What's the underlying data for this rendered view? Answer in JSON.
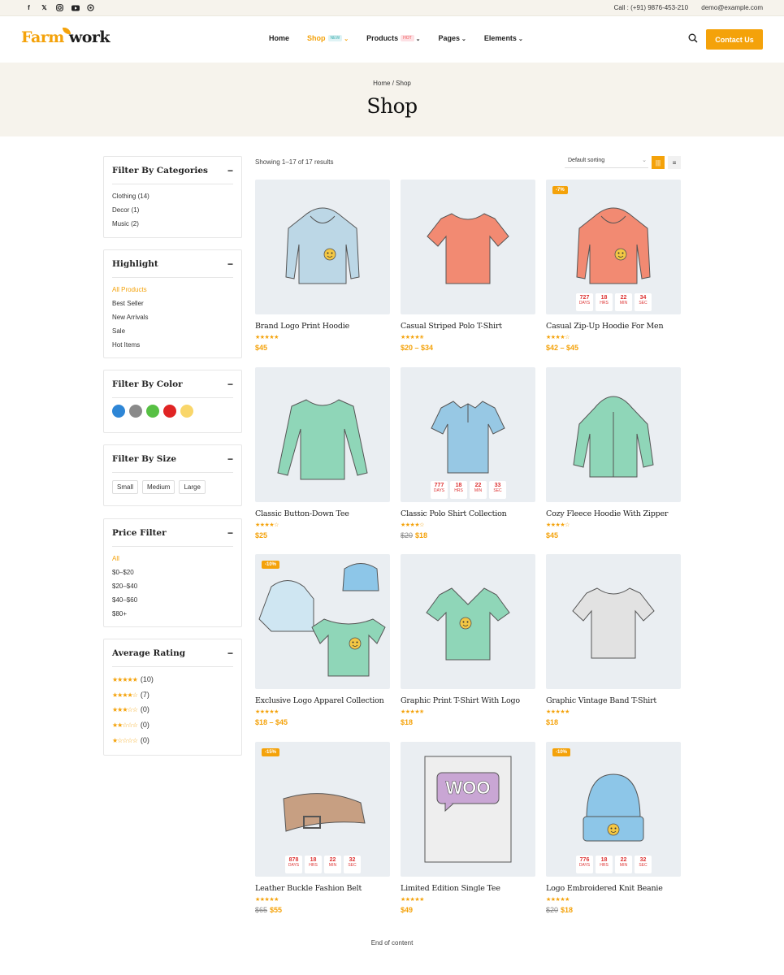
{
  "topbar": {
    "social": [
      "facebook-icon",
      "x-icon",
      "instagram-icon",
      "youtube-icon",
      "whatsapp-icon"
    ],
    "call": "Call : (+91) 9876-453-210",
    "email": "demo@example.com"
  },
  "header": {
    "logo_left": "Farm",
    "logo_right": "work",
    "nav": [
      {
        "label": "Home"
      },
      {
        "label": "Shop",
        "tag": "NEW"
      },
      {
        "label": "Products",
        "tag": "HOT"
      },
      {
        "label": "Pages"
      },
      {
        "label": "Elements"
      }
    ],
    "contact": "Contact Us"
  },
  "hero": {
    "home": "Home",
    "sep": " / ",
    "current": "Shop",
    "title": "Shop"
  },
  "sidebar": {
    "categories": {
      "title": "Filter By Categories",
      "items": [
        "Clothing (14)",
        "Decor (1)",
        "Music (2)"
      ]
    },
    "highlight": {
      "title": "Highlight",
      "items": [
        "All Products",
        "Best Seller",
        "New Arrivals",
        "Sale",
        "Hot Items"
      ]
    },
    "color": {
      "title": "Filter By Color",
      "colors": [
        "#2e86d6",
        "#8a8a8a",
        "#57c044",
        "#e02424",
        "#f9d66a"
      ]
    },
    "size": {
      "title": "Filter By Size",
      "items": [
        "Small",
        "Medium",
        "Large"
      ]
    },
    "price": {
      "title": "Price Filter",
      "items": [
        "All",
        "$0–$20",
        "$20–$40",
        "$40–$60",
        "$80+"
      ]
    },
    "rating": {
      "title": "Average Rating",
      "items": [
        {
          "stars": "★★★★★",
          "count": "(10)"
        },
        {
          "stars": "★★★★☆",
          "count": "(7)"
        },
        {
          "stars": "★★★☆☆",
          "count": "(0)"
        },
        {
          "stars": "★★☆☆☆",
          "count": "(0)"
        },
        {
          "stars": "★☆☆☆☆",
          "count": "(0)"
        }
      ]
    }
  },
  "shop": {
    "results": "Showing 1–17 of 17 results",
    "sort": "Default sorting",
    "end": "End of content"
  },
  "products": [
    {
      "name": "Brand Logo Print Hoodie",
      "stars": "★★★★★",
      "price": "$45",
      "old": "",
      "badge": "",
      "cd": null,
      "art": "hoodie",
      "color": "#bcd7e6"
    },
    {
      "name": "Casual Striped Polo T-Shirt",
      "stars": "★★★★✬",
      "price": "$20 – $34",
      "old": "",
      "badge": "",
      "cd": null,
      "art": "tee",
      "color": "#f28a72"
    },
    {
      "name": "Casual Zip-Up Hoodie For Men",
      "stars": "★★★★☆",
      "price": "$42 – $45",
      "old": "",
      "badge": "-7%",
      "cd": [
        "727",
        "18",
        "22",
        "34"
      ],
      "art": "hoodie",
      "color": "#f28a72"
    },
    {
      "name": "Classic Button-Down Tee",
      "stars": "★★★★☆",
      "price": "$25",
      "old": "",
      "badge": "",
      "cd": null,
      "art": "longsleeve",
      "color": "#8fd6b8"
    },
    {
      "name": "Classic Polo Shirt Collection",
      "stars": "★★★★☆",
      "price": "$18",
      "old": "$20",
      "badge": "",
      "cd": [
        "777",
        "18",
        "22",
        "33"
      ],
      "art": "polo",
      "color": "#97c8e4"
    },
    {
      "name": "Cozy Fleece Hoodie With Zipper",
      "stars": "★★★★☆",
      "price": "$45",
      "old": "",
      "badge": "",
      "cd": null,
      "art": "zip",
      "color": "#8fd6b8"
    },
    {
      "name": "Exclusive Logo Apparel Collection",
      "stars": "★★★★★",
      "price": "$18 – $45",
      "old": "",
      "badge": "-10%",
      "cd": null,
      "art": "bundle",
      "color": "#8fd6b8"
    },
    {
      "name": "Graphic Print T-Shirt With Logo",
      "stars": "★★★★✬",
      "price": "$18",
      "old": "",
      "badge": "",
      "cd": null,
      "art": "vneck",
      "color": "#8fd6b8"
    },
    {
      "name": "Graphic Vintage Band T-Shirt",
      "stars": "★★★★★",
      "price": "$18",
      "old": "",
      "badge": "",
      "cd": null,
      "art": "tee",
      "color": "#e2e2e2"
    },
    {
      "name": "Leather Buckle Fashion Belt",
      "stars": "★★★★★",
      "price": "$55",
      "old": "$65",
      "badge": "-15%",
      "cd": [
        "878",
        "18",
        "22",
        "32"
      ],
      "art": "belt",
      "color": "#c79f82"
    },
    {
      "name": "Limited Edition Single Tee",
      "stars": "★★★★★",
      "price": "$49",
      "old": "",
      "badge": "",
      "cd": null,
      "art": "woo",
      "color": "#c9a6d4"
    },
    {
      "name": "Logo Embroidered Knit Beanie",
      "stars": "★★★★★",
      "price": "$18",
      "old": "$20",
      "badge": "-10%",
      "cd": [
        "776",
        "18",
        "22",
        "32"
      ],
      "art": "beanie",
      "color": "#8dc6e8"
    }
  ],
  "countdown_units": [
    "DAYS",
    "HRS",
    "MIN",
    "SEC"
  ]
}
